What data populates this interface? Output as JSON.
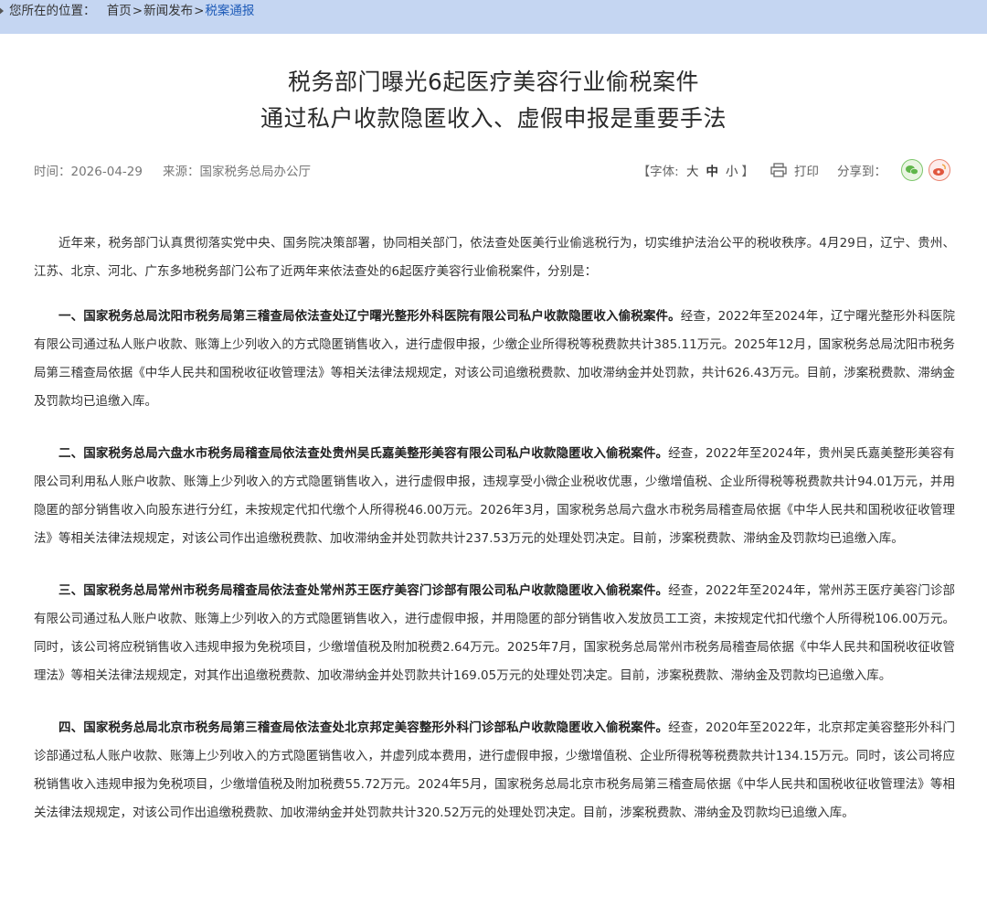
{
  "breadcrumb": {
    "label": "您所在的位置：",
    "items": [
      "首页",
      "新闻发布",
      "税案通报"
    ],
    "separator": ">"
  },
  "article": {
    "title_line1": "税务部门曝光6起医疗美容行业偷税案件",
    "title_line2": "通过私户收款隐匿收入、虚假申报是重要手法",
    "time_label": "时间：",
    "time_value": "2026-04-29",
    "source_label": "来源：",
    "source_value": "国家税务总局办公厅"
  },
  "tools": {
    "font_label_open": "【字体:",
    "font_large": "大",
    "font_medium": "中",
    "font_small": "小",
    "font_label_close": "】",
    "print_label": "打印",
    "share_label": "分享到：",
    "share_icons": [
      "wechat-icon",
      "weibo-icon"
    ]
  },
  "paragraphs": [
    {
      "bold": "",
      "text": "近年来，税务部门认真贯彻落实党中央、国务院决策部署，协同相关部门，依法查处医美行业偷逃税行为，切实维护法治公平的税收秩序。4月29日，辽宁、贵州、江苏、北京、河北、广东多地税务部门公布了近两年来依法查处的6起医疗美容行业偷税案件，分别是："
    },
    {
      "bold": "一、国家税务总局沈阳市税务局第三稽查局依法查处辽宁曙光整形外科医院有限公司私户收款隐匿收入偷税案件。",
      "text": "经查，2022年至2024年，辽宁曙光整形外科医院有限公司通过私人账户收款、账簿上少列收入的方式隐匿销售收入，进行虚假申报，少缴企业所得税等税费款共计385.11万元。2025年12月，国家税务总局沈阳市税务局第三稽查局依据《中华人民共和国税收征收管理法》等相关法律法规规定，对该公司追缴税费款、加收滞纳金并处罚款，共计626.43万元。目前，涉案税费款、滞纳金及罚款均已追缴入库。"
    },
    {
      "bold": "二、国家税务总局六盘水市税务局稽查局依法查处贵州吴氏嘉美整形美容有限公司私户收款隐匿收入偷税案件。",
      "text": "经查，2022年至2024年，贵州吴氏嘉美整形美容有限公司利用私人账户收款、账簿上少列收入的方式隐匿销售收入，进行虚假申报，违规享受小微企业税收优惠，少缴增值税、企业所得税等税费款共计94.01万元，并用隐匿的部分销售收入向股东进行分红，未按规定代扣代缴个人所得税46.00万元。2026年3月，国家税务总局六盘水市税务局稽查局依据《中华人民共和国税收征收管理法》等相关法律法规规定，对该公司作出追缴税费款、加收滞纳金并处罚款共计237.53万元的处理处罚决定。目前，涉案税费款、滞纳金及罚款均已追缴入库。"
    },
    {
      "bold": "三、国家税务总局常州市税务局稽查局依法查处常州苏王医疗美容门诊部有限公司私户收款隐匿收入偷税案件。",
      "text": "经查，2022年至2024年，常州苏王医疗美容门诊部有限公司通过私人账户收款、账簿上少列收入的方式隐匿销售收入，进行虚假申报，并用隐匿的部分销售收入发放员工工资，未按规定代扣代缴个人所得税106.00万元。同时，该公司将应税销售收入违规申报为免税项目，少缴增值税及附加税费2.64万元。2025年7月，国家税务总局常州市税务局稽查局依据《中华人民共和国税收征收管理法》等相关法律法规规定，对其作出追缴税费款、加收滞纳金并处罚款共计169.05万元的处理处罚决定。目前，涉案税费款、滞纳金及罚款均已追缴入库。"
    },
    {
      "bold": "四、国家税务总局北京市税务局第三稽查局依法查处北京邦定美容整形外科门诊部私户收款隐匿收入偷税案件。",
      "text": "经查，2020年至2022年，北京邦定美容整形外科门诊部通过私人账户收款、账簿上少列收入的方式隐匿销售收入，并虚列成本费用，进行虚假申报，少缴增值税、企业所得税等税费款共计134.15万元。同时，该公司将应税销售收入违规申报为免税项目，少缴增值税及附加税费55.72万元。2024年5月，国家税务总局北京市税务局第三稽查局依据《中华人民共和国税收征收管理法》等相关法律法规规定，对该公司作出追缴税费款、加收滞纳金并处罚款共计320.52万元的处理处罚决定。目前，涉案税费款、滞纳金及罚款均已追缴入库。"
    }
  ]
}
